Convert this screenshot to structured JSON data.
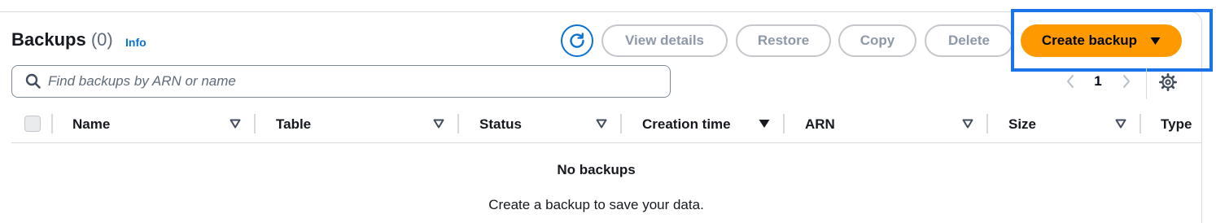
{
  "header": {
    "title": "Backups",
    "count": "(0)",
    "info_link": "Info"
  },
  "actions": {
    "refresh_icon": "refresh-icon",
    "view_details": "View details",
    "restore": "Restore",
    "copy": "Copy",
    "delete": "Delete",
    "create_backup": "Create backup",
    "create_backup_icon": "caret-down-icon",
    "disabled_color": "#8d99a8",
    "primary_color": "#ff9900"
  },
  "search": {
    "placeholder": "Find backups by ARN or name",
    "value": "",
    "icon": "search-icon"
  },
  "pagination": {
    "current_page": "1",
    "prev_icon": "chevron-left-icon",
    "next_icon": "chevron-right-icon",
    "settings_icon": "gear-icon"
  },
  "table": {
    "columns": [
      {
        "label": "Name",
        "sort_icon": "sort-outline-icon"
      },
      {
        "label": "Table",
        "sort_icon": "sort-outline-icon"
      },
      {
        "label": "Status",
        "sort_icon": "sort-outline-icon"
      },
      {
        "label": "Creation time",
        "sort_icon": "sort-descending-icon"
      },
      {
        "label": "ARN",
        "sort_icon": "sort-outline-icon"
      },
      {
        "label": "Size",
        "sort_icon": "sort-outline-icon"
      },
      {
        "label": "Type"
      }
    ],
    "rows": [],
    "empty_title": "No backups",
    "empty_description": "Create a backup to save your data."
  },
  "highlight_color": "#1a73e8"
}
